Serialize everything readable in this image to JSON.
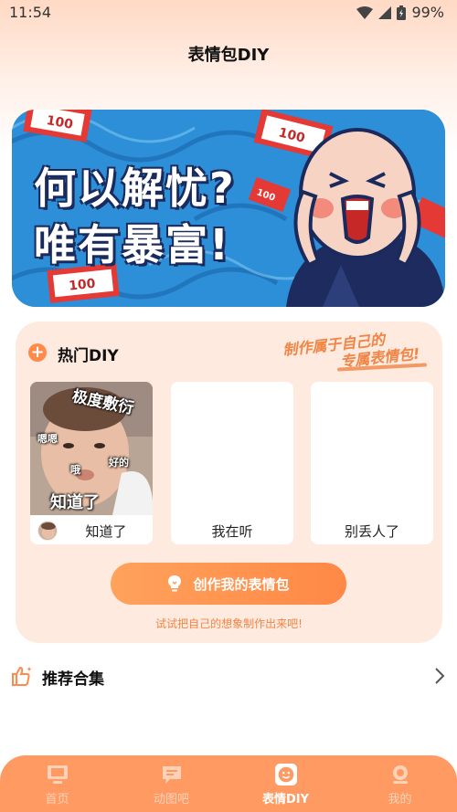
{
  "status_bar": {
    "time": "11:54",
    "battery": "99%"
  },
  "page": {
    "title": "表情包DIY"
  },
  "banner": {
    "line1": "何以解忧?",
    "line2": "唯有暴富!",
    "money_label": "100"
  },
  "hot": {
    "title": "热门DIY",
    "slogan_line1": "制作属于自己的",
    "slogan_line2": "专属表情包!",
    "memes": [
      {
        "caption": "知道了",
        "photo_texts": [
          "极度敷衍",
          "嗯嗯",
          "哦",
          "好的",
          "知道了"
        ]
      },
      {
        "caption": "我在听"
      },
      {
        "caption": "别丢人了"
      }
    ],
    "create_button": "创作我的表情包",
    "hint": "试试把自己的想象制作出来吧!"
  },
  "recommend": {
    "title": "推荐合集"
  },
  "tabs": [
    {
      "label": "首页",
      "icon": "tv-icon",
      "active": false
    },
    {
      "label": "动图吧",
      "icon": "chat-image-icon",
      "active": false
    },
    {
      "label": "表情DIY",
      "icon": "smiley-icon",
      "active": true
    },
    {
      "label": "我的",
      "icon": "profile-icon",
      "active": false
    }
  ],
  "colors": {
    "accent": "#FF9A63",
    "card_bg": "#FFEADF",
    "banner_blue": "#2C8FD8"
  }
}
